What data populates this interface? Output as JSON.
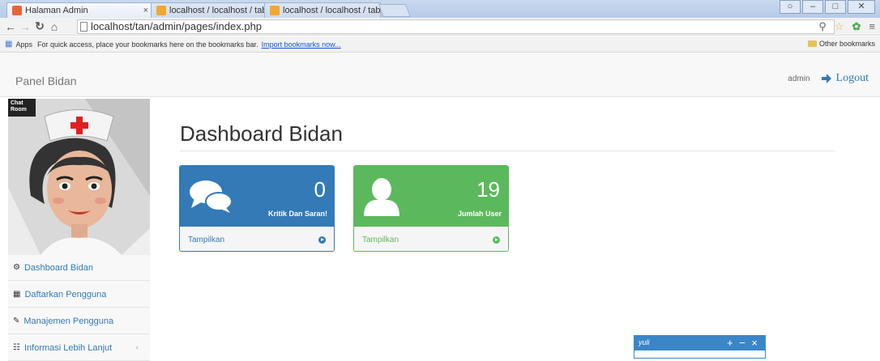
{
  "browser": {
    "tabs": [
      {
        "title": "Halaman Admin",
        "close": "×"
      },
      {
        "title": "localhost / localhost / tab",
        "close": "×"
      },
      {
        "title": "localhost / localhost / tab",
        "close": "×"
      }
    ],
    "url": "localhost/tan/admin/pages/index.php",
    "bookmarks_bar": {
      "apps": "Apps",
      "hint": "For quick access, place your bookmarks here on the bookmarks bar.",
      "import_link": "Import bookmarks now...",
      "other": "Other bookmarks"
    }
  },
  "navbar": {
    "brand": "Panel Bidan",
    "user": "admin",
    "logout": "Logout"
  },
  "sidebar": {
    "chat_label": "Chat Room",
    "items": [
      {
        "label": "Dashboard Bidan",
        "icon": "dashboard-icon"
      },
      {
        "label": "Daftarkan Pengguna",
        "icon": "table-icon"
      },
      {
        "label": "Manajemen Pengguna",
        "icon": "edit-icon"
      },
      {
        "label": "Informasi Lebih Lanjut",
        "icon": "sitemap-icon"
      }
    ]
  },
  "main": {
    "title": "Dashboard Bidan",
    "panels": [
      {
        "count": "0",
        "caption": "Kritik Dan Saran!",
        "link": "Tampilkan",
        "color": "#337ab7",
        "icon": "comments-icon"
      },
      {
        "count": "19",
        "caption": "Jumlah User",
        "link": "Tampilkan",
        "color": "#5cb85c",
        "icon": "user-icon"
      }
    ]
  },
  "chat": {
    "name": "yuli",
    "controls": "+ − ×"
  }
}
